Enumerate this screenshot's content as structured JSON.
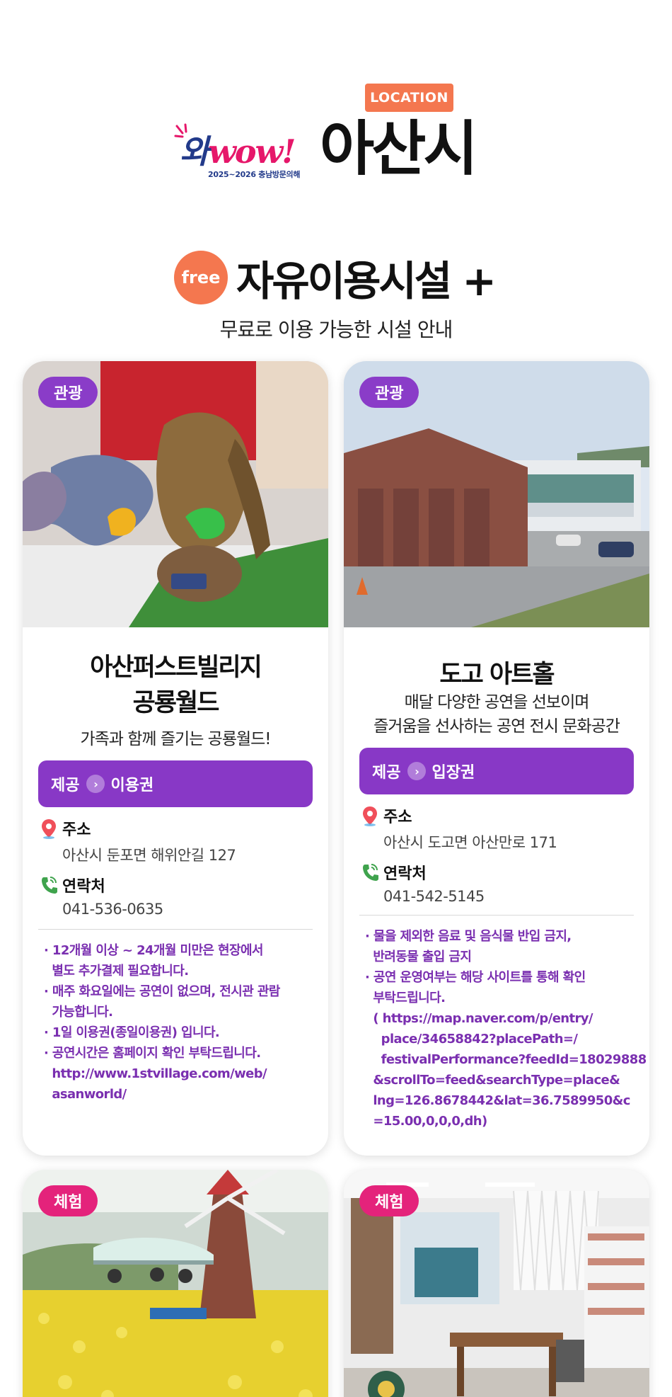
{
  "header": {
    "location_badge": "LOCATION",
    "logo_word_a": "와",
    "logo_word_b": "wow!",
    "logo_sub": "2025~2026 충남방문의해",
    "city": "아산시"
  },
  "section": {
    "free_badge": "free",
    "title": "자유이용시설 +",
    "subtitle": "무료로 이용 가능한 시설 안내"
  },
  "cards": [
    {
      "tag": "관광",
      "title_lines": [
        "아산퍼스트빌리지",
        "공룡월드"
      ],
      "desc_lines": [
        "가족과 함께 즐기는 공룡월드!"
      ],
      "provide_label": "제공",
      "provide_value": "이용권",
      "address_label": "주소",
      "address": "아산시 둔포면 해위안길 127",
      "contact_label": "연락처",
      "phone": "041-536-0635",
      "notes": [
        "· 12개월 이상 ~ 24개월 미만은 현장에서",
        "  별도 추가결제 필요합니다.",
        "· 매주 화요일에는 공연이 없으며, 전시관 관람",
        "  가능합니다.",
        "· 1일 이용권(종일이용권) 입니다.",
        "· 공연시간은 홈페이지 확인 부탁드립니다.",
        "  http://www.1stvillage.com/web/",
        "  asanworld/"
      ]
    },
    {
      "tag": "관광",
      "title_lines": [
        "도고 아트홀"
      ],
      "desc_lines": [
        "매달 다양한 공연을 선보이며",
        "즐거움을 선사하는 공연 전시 문화공간"
      ],
      "provide_label": "제공",
      "provide_value": "입장권",
      "address_label": "주소",
      "address": "아산시 도고면 아산만로 171",
      "contact_label": "연락처",
      "phone": "041-542-5145",
      "notes": [
        "· 물을 제외한 음료 및 음식물 반입 금지,",
        "  반려동물 출입 금지",
        "· 공연 운영여부는 해당 사이트를 통해 확인",
        "  부탁드립니다.",
        "  ( https://map.naver.com/p/entry/",
        "    place/34658842?placePath=/",
        "    festivalPerformance?feedId=18029888",
        "  &scrollTo=feed&searchType=place&",
        "  lng=126.8678442&lat=36.7589950&c",
        "  =15.00,0,0,0,dh)"
      ]
    },
    {
      "tag": "체험"
    },
    {
      "tag": "체험"
    }
  ],
  "colors": {
    "accent_orange": "#f4774f",
    "purple": "#8838c6",
    "pink": "#e4237b",
    "note_purple": "#7a2fb0"
  }
}
